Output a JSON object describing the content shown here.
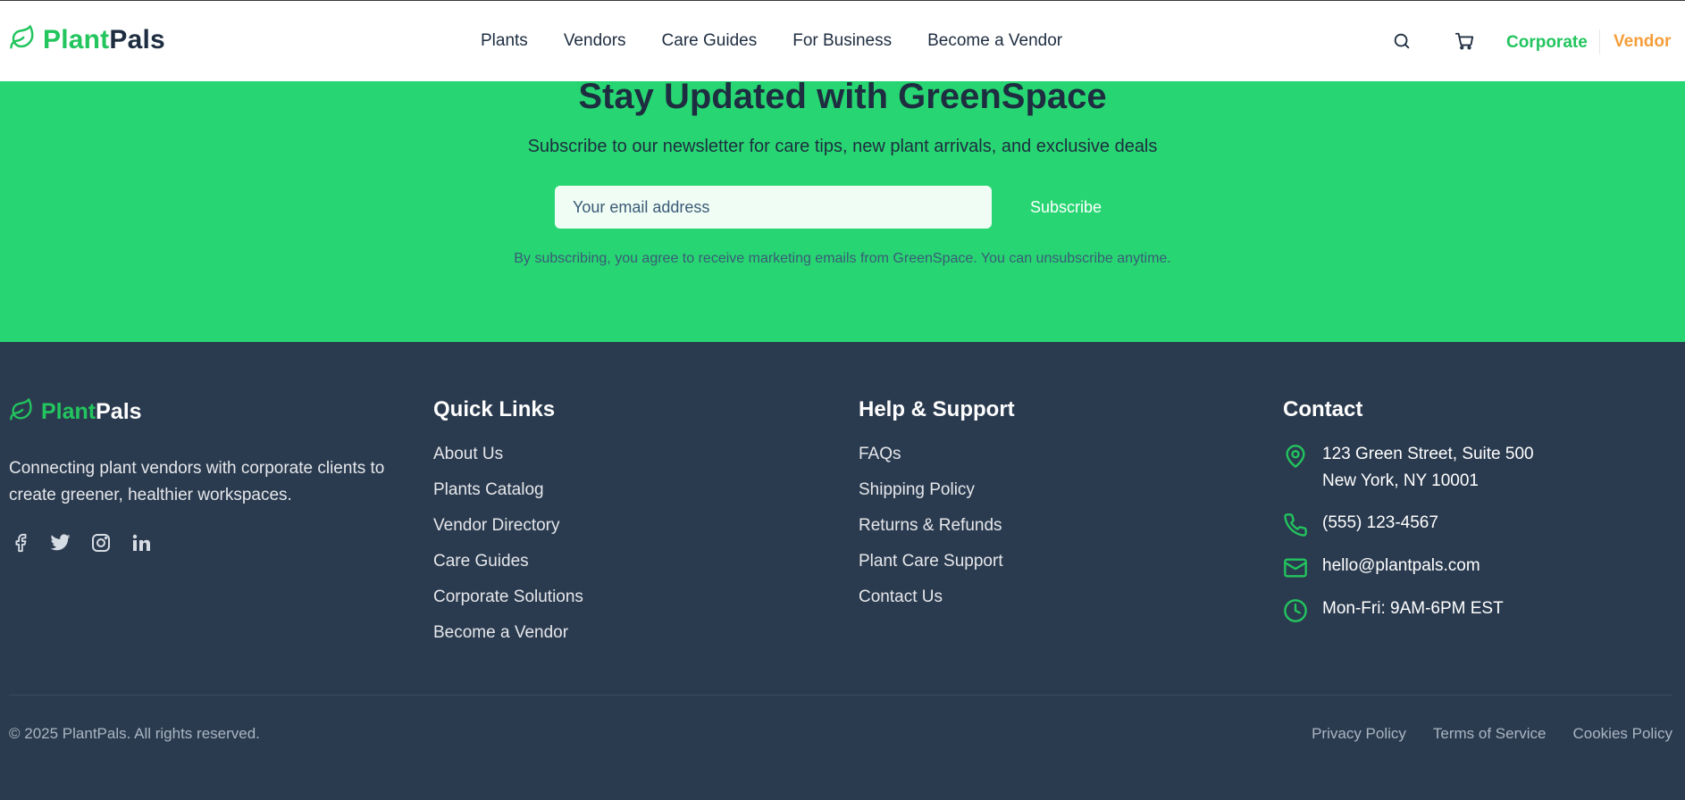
{
  "header": {
    "brand_a": "Plant",
    "brand_b": "Pals",
    "nav": [
      "Plants",
      "Vendors",
      "Care Guides",
      "For Business",
      "Become a Vendor"
    ],
    "corporate_label": "Corporate",
    "vendor_label": "Vendor",
    "icons": [
      "leaf-icon",
      "search-icon",
      "cart-icon"
    ]
  },
  "newsletter": {
    "title": "Stay Updated with GreenSpace",
    "subtitle": "Subscribe to our newsletter for care tips, new plant arrivals, and exclusive deals",
    "email_placeholder": "Your email address",
    "subscribe_label": "Subscribe",
    "note": "By subscribing, you agree to receive marketing emails from GreenSpace. You can unsubscribe anytime."
  },
  "footer": {
    "brand_a": "Plant",
    "brand_b": "Pals",
    "description": "Connecting plant vendors with corporate clients to create greener, healthier workspaces.",
    "socials": [
      "facebook-icon",
      "twitter-icon",
      "instagram-icon",
      "linkedin-icon"
    ],
    "quick_links": {
      "title": "Quick Links",
      "items": [
        "About Us",
        "Plants Catalog",
        "Vendor Directory",
        "Care Guides",
        "Corporate Solutions",
        "Become a Vendor"
      ]
    },
    "support": {
      "title": "Help & Support",
      "items": [
        "FAQs",
        "Shipping Policy",
        "Returns & Refunds",
        "Plant Care Support",
        "Contact Us"
      ]
    },
    "contact": {
      "title": "Contact",
      "address_line1": "123 Green Street, Suite 500",
      "address_line2": "New York, NY 10001",
      "phone": "(555) 123-4567",
      "email": "hello@plantpals.com",
      "hours": "Mon-Fri: 9AM-6PM EST"
    },
    "copyright": "© 2025 PlantPals. All rights reserved.",
    "legal": [
      "Privacy Policy",
      "Terms of Service",
      "Cookies Policy"
    ]
  },
  "colors": {
    "brand_green": "#22c55e",
    "newsletter_bg": "#27d672",
    "footer_bg": "#2b3b4f",
    "vendor_orange": "#f59e3b",
    "navy": "#1e2d40"
  }
}
